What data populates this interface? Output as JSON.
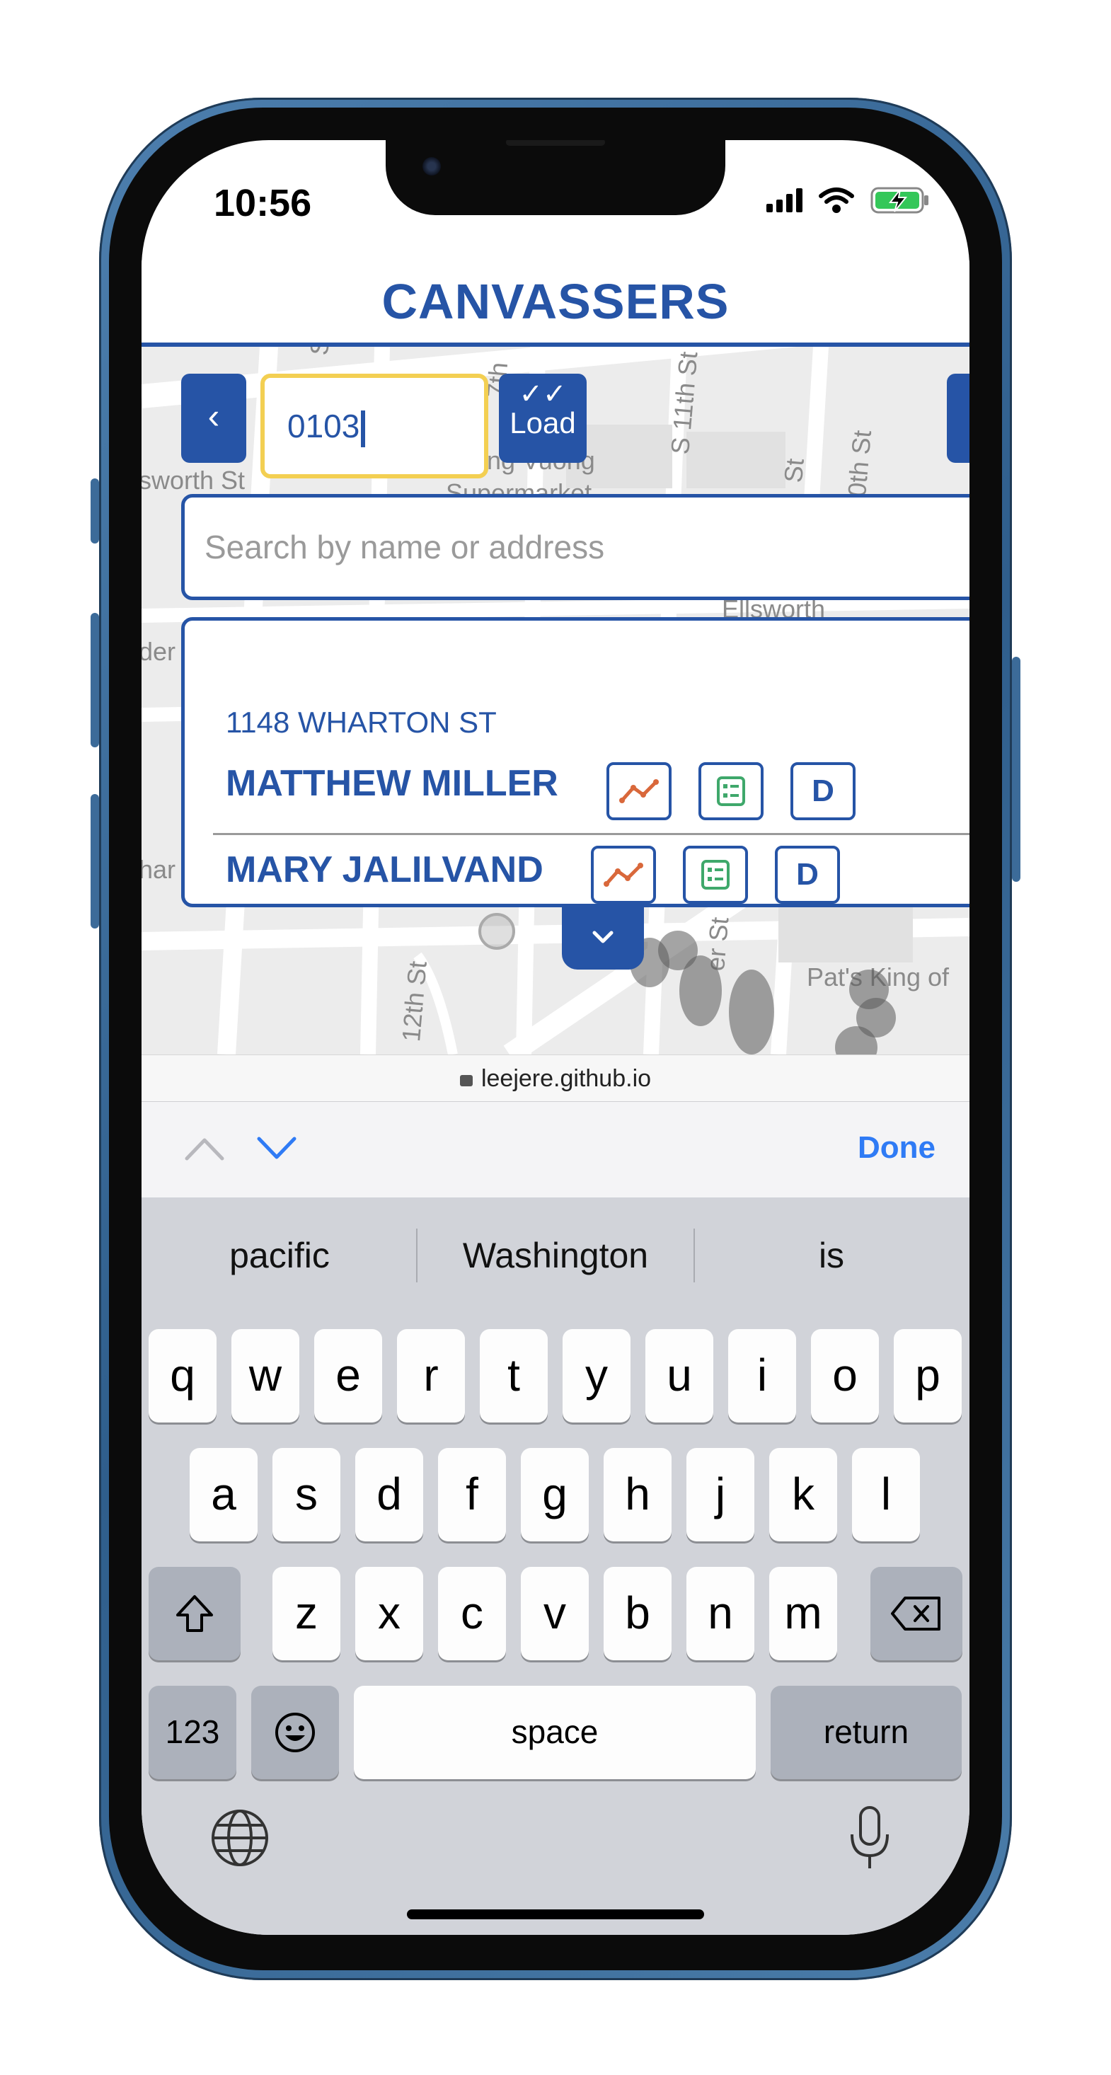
{
  "status": {
    "time": "10:56"
  },
  "app": {
    "title": "CANVASSERS"
  },
  "controls": {
    "back_icon": "chevron-left-icon",
    "id_input_value": "0103",
    "load_label": "Load",
    "load_icon": "double-check-icon"
  },
  "search": {
    "placeholder": "Search by name or address"
  },
  "map": {
    "streets": [
      "St",
      "7th",
      "S 11th St",
      "St",
      "0th St",
      "sworth St",
      "ng Vuong",
      "Supermarket",
      "Ellsworth",
      "der",
      "har",
      "12th St",
      "er St",
      "Pat's King of"
    ]
  },
  "results": {
    "address": "1148 WHARTON ST",
    "voters": [
      {
        "name": "MATTHEW MILLER",
        "history_icon": "line-chart-icon",
        "details_icon": "list-icon",
        "party": "D"
      },
      {
        "name": "MARY JALILVAND",
        "history_icon": "line-chart-icon",
        "details_icon": "list-icon",
        "party": "D"
      }
    ]
  },
  "browser": {
    "url": "leejere.github.io"
  },
  "accessory_bar": {
    "done_label": "Done"
  },
  "keyboard": {
    "suggestions": [
      "pacific",
      "Washington",
      "is"
    ],
    "row1": [
      "q",
      "w",
      "e",
      "r",
      "t",
      "y",
      "u",
      "i",
      "o",
      "p"
    ],
    "row2": [
      "a",
      "s",
      "d",
      "f",
      "g",
      "h",
      "j",
      "k",
      "l"
    ],
    "row3": [
      "z",
      "x",
      "c",
      "v",
      "b",
      "n",
      "m"
    ],
    "numbers_label": "123",
    "space_label": "space",
    "return_label": "return"
  },
  "colors": {
    "brand_blue": "#2654a6",
    "input_focus": "#f3cf52",
    "ios_blue": "#2f7bf5",
    "battery_green": "#34c759"
  }
}
